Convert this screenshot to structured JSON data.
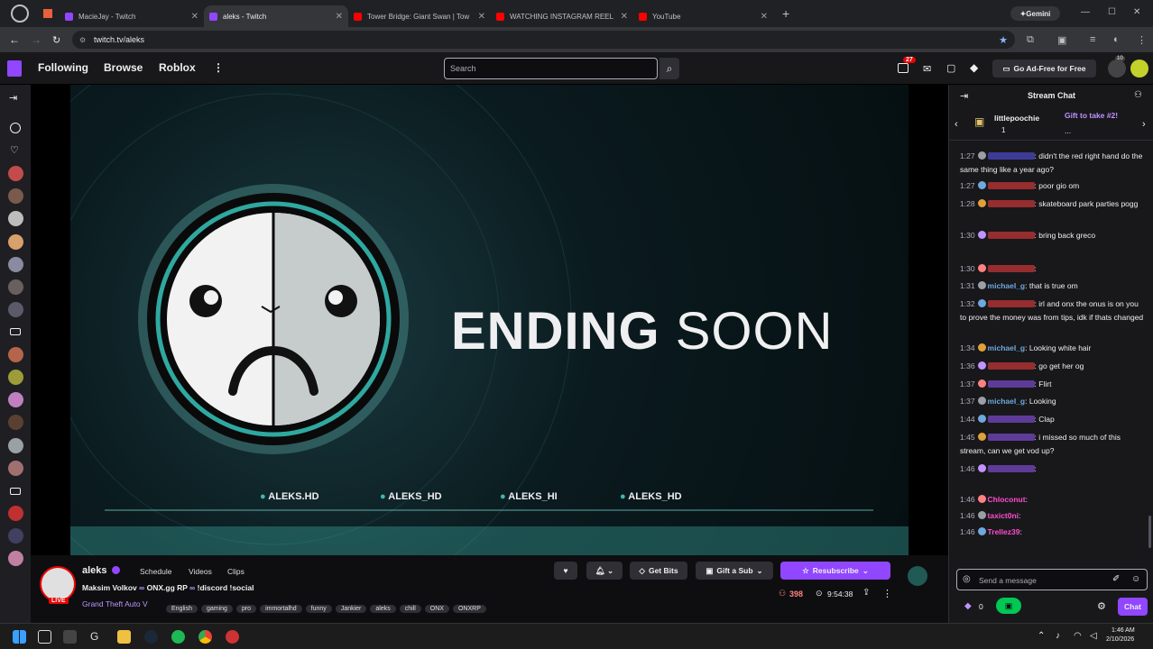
{
  "browser": {
    "tabs": [
      {
        "title": "MacieJay - Twitch",
        "color": "#9146ff"
      },
      {
        "title": "aleks - Twitch",
        "color": "#9146ff"
      },
      {
        "title": "Tower Bridge: Giant Swan | Tow",
        "color": "#ff0000"
      },
      {
        "title": "WATCHING INSTAGRAM REEL",
        "color": "#ff0000"
      },
      {
        "title": "YouTube",
        "color": "#ff0000"
      }
    ],
    "gemini_label": "Gemini",
    "url": "twitch.tv/aleks"
  },
  "nav": {
    "following": "Following",
    "browse": "Browse",
    "roblox": "Roblox",
    "search_placeholder": "Search",
    "notif_count": "27",
    "ad_free": "Go Ad-Free for Free",
    "avatar_badge": "10"
  },
  "stream": {
    "headline_bold": "ENDING",
    "headline_light": "SOON",
    "socials": [
      "ALEKS.HD",
      "ALEKS_HD",
      "ALEKS_HI",
      "ALEKS_HD"
    ],
    "channel": "aleks",
    "title_parts": [
      "Maksim Volkov",
      "ONX.gg RP",
      "!discord !social"
    ],
    "game": "Grand Theft Auto V",
    "tags": [
      "English",
      "gaming",
      "pro",
      "immortalhd",
      "funny",
      "Jankier",
      "aleks",
      "chill",
      "ONX",
      "ONXRP"
    ],
    "viewers": "398",
    "uptime": "9:54:38",
    "live_label": "LIVE",
    "schedule": "Schedule",
    "videos": "Videos",
    "clips": "Clips",
    "get_bits": "Get Bits",
    "gift_sub": "Gift a Sub",
    "resubscribe": "Resubscribe"
  },
  "chat": {
    "title": "Stream Chat",
    "pinned_user": "littlepoochie",
    "pinned_count": "1",
    "pinned_text": "Gift to take #2!",
    "pinned_more": "...",
    "messages": [
      {
        "time": "1:27",
        "user": "",
        "text": ": didn't the red right hand do the same thing like a year ago?",
        "color": "#5b5bff"
      },
      {
        "time": "1:27",
        "user": "",
        "text": ": poor gio om",
        "color": "#ff4040"
      },
      {
        "time": "1:28",
        "user": "",
        "text": ": skateboard park parties pogg",
        "color": "#ff4040"
      },
      {
        "time": "1:30",
        "user": "",
        "text": ": bring back greco",
        "color": "#ff4040"
      },
      {
        "time": "1:30",
        "user": "",
        "text": ":",
        "color": "#ff4040"
      },
      {
        "time": "1:31",
        "user": "michaeI_g",
        "text": ": that is true om",
        "color": "#6fa8dc"
      },
      {
        "time": "1:32",
        "user": "",
        "text": ": irl and onx the onus is on you to prove the money was from tips, idk if thats changed",
        "color": "#ff4040"
      },
      {
        "time": "1:34",
        "user": "michaeI_g",
        "text": ": Looking white hair",
        "color": "#6fa8dc"
      },
      {
        "time": "1:36",
        "user": "",
        "text": ": go get her og",
        "color": "#ff4040"
      },
      {
        "time": "1:37",
        "user": "",
        "text": ": Flirt",
        "color": "#9b59ff"
      },
      {
        "time": "1:37",
        "user": "michaeI_g",
        "text": ": Looking",
        "color": "#6fa8dc"
      },
      {
        "time": "1:44",
        "user": "",
        "text": ": Clap",
        "color": "#9b59ff"
      },
      {
        "time": "1:45",
        "user": "",
        "text": ": i missed so much of this stream, can we get vod up?",
        "color": "#9b59ff"
      },
      {
        "time": "1:46",
        "user": "",
        "text": ":",
        "color": "#9b59ff"
      },
      {
        "time": "1:46",
        "user": "Chloconut",
        "text": ":",
        "color": "#ff4dcf"
      },
      {
        "time": "1:46",
        "user": "taxict0ni",
        "text": ":",
        "color": "#ff4dcf"
      },
      {
        "time": "1:46",
        "user": "Trellez39",
        "text": ":",
        "color": "#ff4dcf"
      }
    ],
    "input_placeholder": "Send a message",
    "points": "0",
    "send": "Chat"
  },
  "taskbar": {
    "time": "1:46 AM",
    "date": "2/10/2026"
  }
}
